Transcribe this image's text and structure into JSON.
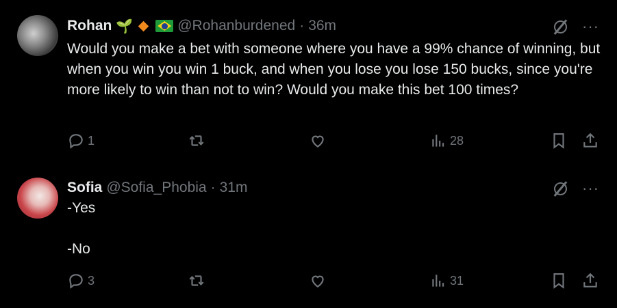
{
  "tweets": [
    {
      "name": "Rohan",
      "handle": "@Rohanburdened",
      "dot": "·",
      "time": "36m",
      "text": "Would you make a bet with someone where you have a 99% chance of winning, but when you win you win 1 buck, and when you lose you lose 150 bucks, since you're more likely to win than not to win? Would you make this bet 100 times?",
      "reply_count": "1",
      "views": "28",
      "more": "···"
    },
    {
      "name": "Sofia",
      "handle": "@Sofia_Phobia",
      "dot": "·",
      "time": "31m",
      "text": "-Yes\n\n-No",
      "reply_count": "3",
      "views": "31",
      "more": "···"
    }
  ],
  "badges": {
    "sprout": "🌱"
  },
  "colors": {
    "background": "#000000",
    "text": "#e7e9ea",
    "muted": "#71767b",
    "diamond": "#f08a1d"
  }
}
